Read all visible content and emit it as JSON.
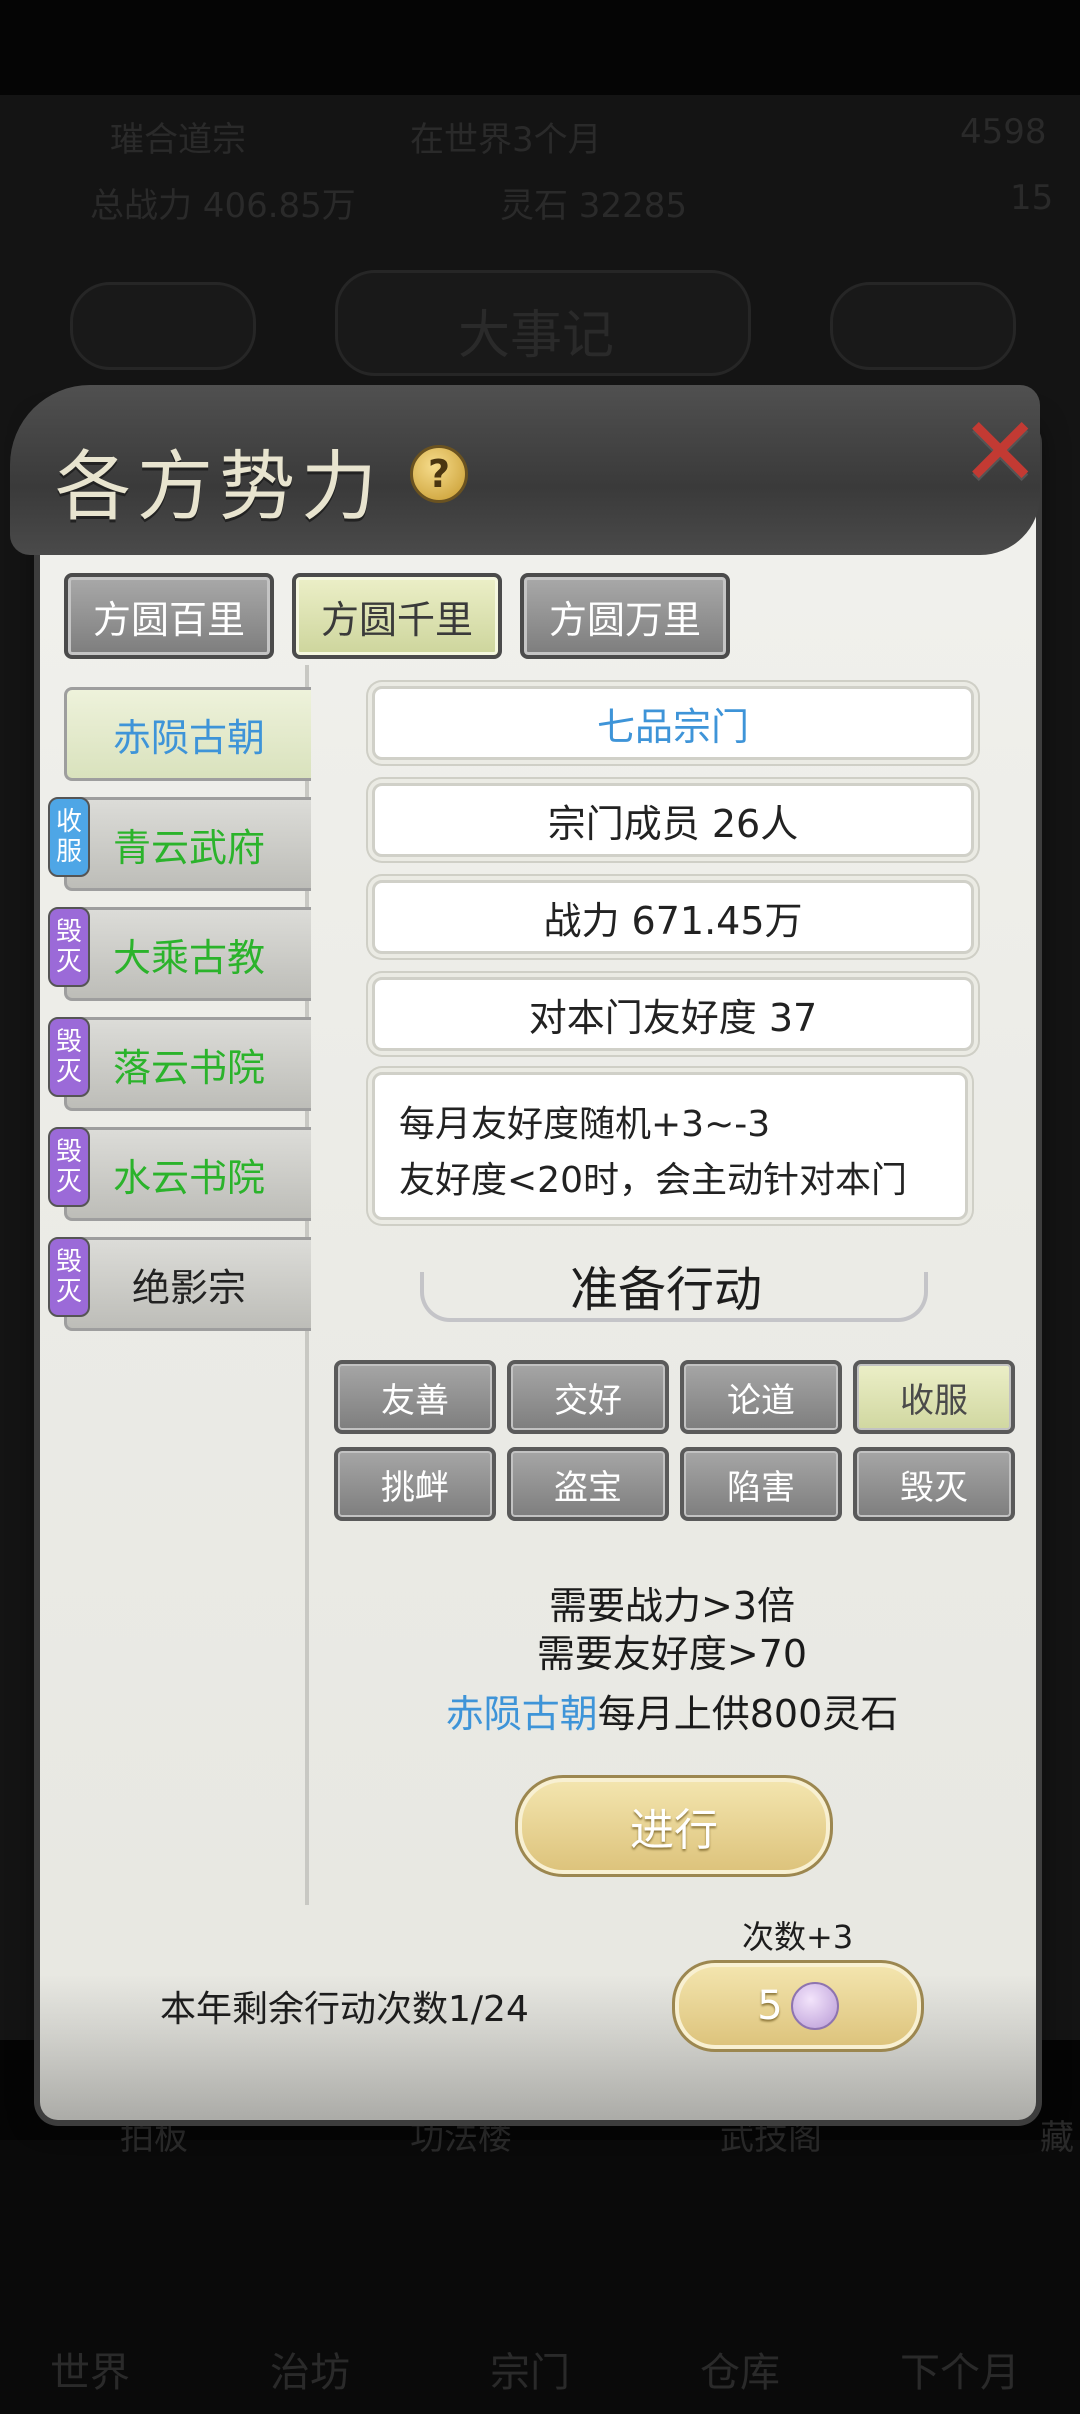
{
  "background": {
    "sect_name": "璀合道宗",
    "time": "在世界3个月",
    "top_right": "4598",
    "power": "总战力 406.85万",
    "stone": "灵石 32285",
    "right_num": "15",
    "chronicle": "大事记",
    "bottom_labels": [
      "拍板",
      "功法楼",
      "武技阁",
      "藏"
    ],
    "nav_labels": [
      "世界",
      "治坊",
      "宗门",
      "仓库",
      "下个月"
    ]
  },
  "panel": {
    "title": "各方势力",
    "help_label": "?",
    "close_label": "✕"
  },
  "tabs": [
    {
      "label": "方圆百里",
      "active": false
    },
    {
      "label": "方圆千里",
      "active": true
    },
    {
      "label": "方圆万里",
      "active": false
    }
  ],
  "factions": [
    {
      "name": "赤陨古朝",
      "badge": "",
      "color": "#3e94d8",
      "selected": true
    },
    {
      "name": "青云武府",
      "badge": "收服",
      "color": "#2bb32b",
      "badge_color": "#4ea6e6",
      "selected": false
    },
    {
      "name": "大乘古教",
      "badge": "毁灭",
      "color": "#2bb32b",
      "badge_color": "#9b6ad8",
      "selected": false
    },
    {
      "name": "落云书院",
      "badge": "毁灭",
      "color": "#2bb32b",
      "badge_color": "#9b6ad8",
      "selected": false
    },
    {
      "name": "水云书院",
      "badge": "毁灭",
      "color": "#2bb32b",
      "badge_color": "#9b6ad8",
      "selected": false
    },
    {
      "name": "绝影宗",
      "badge": "毁灭",
      "color": "#222222",
      "badge_color": "#9b6ad8",
      "selected": false
    }
  ],
  "info": {
    "rank": "七品宗门",
    "members": "宗门成员 26人",
    "power": "战力 671.45万",
    "friendship": "对本门友好度 37",
    "desc_line1": "每月友好度随机+3~-3",
    "desc_line2": "友好度<20时，会主动针对本门"
  },
  "actions": {
    "title": "准备行动",
    "buttons": [
      {
        "label": "友善",
        "active": false
      },
      {
        "label": "交好",
        "active": false
      },
      {
        "label": "论道",
        "active": false
      },
      {
        "label": "收服",
        "active": true
      },
      {
        "label": "挑衅",
        "active": false
      },
      {
        "label": "盗宝",
        "active": false
      },
      {
        "label": "陷害",
        "active": false
      },
      {
        "label": "毁灭",
        "active": false
      }
    ]
  },
  "requirements": {
    "line1": "需要战力>3倍",
    "line2": "需要友好度>70",
    "line3_faction": "赤陨古朝",
    "line3_rest": "每月上供800灵石"
  },
  "go_label": "进行",
  "footer": {
    "remaining": "本年剩余行动次数1/24",
    "count_plus": "次数+3",
    "cost": "5"
  }
}
